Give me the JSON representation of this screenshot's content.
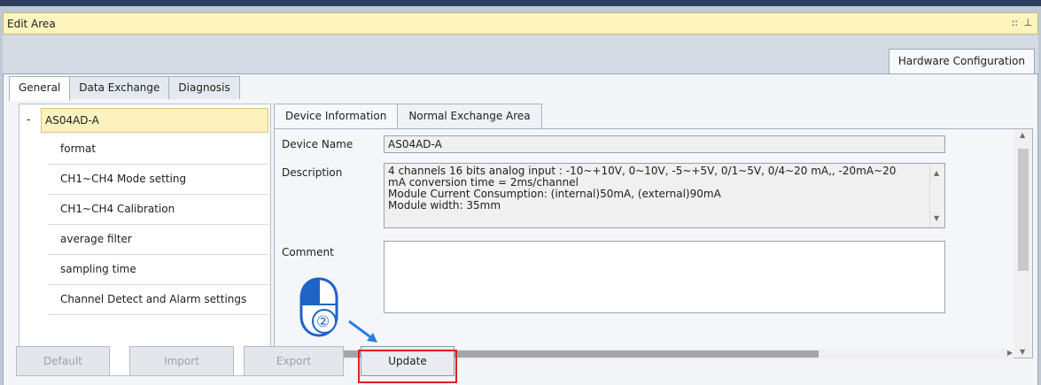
{
  "window": {
    "title": "Edit Area",
    "title_controls": [
      "::",
      "⊥"
    ]
  },
  "outer_tabs": {
    "active_label": "Hardware Configuration"
  },
  "config_tabs": [
    {
      "label": "General"
    },
    {
      "label": "Data Exchange"
    },
    {
      "label": "Diagnosis"
    }
  ],
  "tree": {
    "toggle": "-",
    "root": "AS04AD-A",
    "items": [
      {
        "label": "format"
      },
      {
        "label": "CH1~CH4 Mode setting"
      },
      {
        "label": "CH1~CH4 Calibration"
      },
      {
        "label": "average filter"
      },
      {
        "label": "sampling time"
      },
      {
        "label": "Channel Detect and Alarm settings"
      }
    ]
  },
  "detail_tabs": [
    {
      "label": "Device Information"
    },
    {
      "label": "Normal Exchange Area"
    }
  ],
  "device_info": {
    "name_label": "Device Name",
    "name_value": "AS04AD-A",
    "description_label": "Description",
    "description_lines": [
      "4 channels 16 bits analog input : -10~+10V, 0~10V, -5~+5V, 0/1~5V, 0/4~20 mA,, -20mA~20",
      "mA conversion time = 2ms/channel",
      "Module Current Consumption: (internal)50mA, (external)90mA",
      "Module width: 35mm"
    ],
    "comment_label": "Comment",
    "comment_value": ""
  },
  "buttons": {
    "default_label": "Default",
    "import_label": "Import",
    "export_label": "Export",
    "update_label": "Update"
  },
  "annotation": {
    "step_number": "②",
    "colors": {
      "highlight": "#e02020",
      "arrow": "#2f7fd8",
      "mouse": "#1f63c6"
    }
  }
}
